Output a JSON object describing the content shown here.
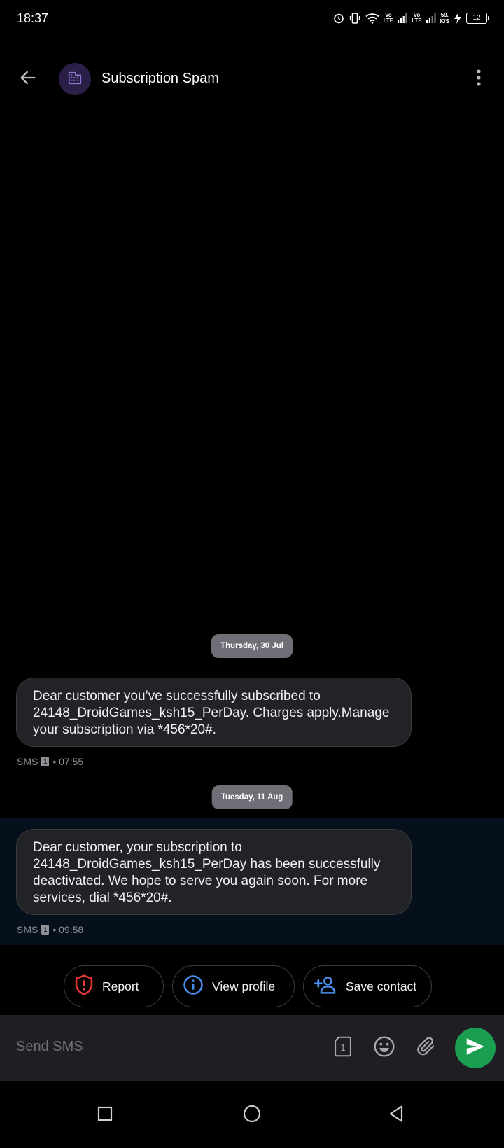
{
  "status_bar": {
    "time": "18:37",
    "lte1": "Vo\nLTE",
    "lte2": "Vo\nLTE",
    "speed": "59.\nK/S",
    "battery": "12"
  },
  "header": {
    "title": "Subscription Spam"
  },
  "conversation": [
    {
      "date": "Thursday, 30 Jul",
      "text": "Dear customer you’ve successfully subscribed to 24148_DroidGames_ksh15_PerDay. Charges apply.Manage your subscription via *456*20#.",
      "channel": "SMS",
      "sim": "1",
      "time": "• 07:55"
    },
    {
      "date": "Tuesday, 11 Aug",
      "text": "Dear customer, your subscription to 24148_DroidGames_ksh15_PerDay has been successfully deactivated. We hope to serve you again soon. For more services, dial *456*20#.",
      "channel": "SMS",
      "sim": "1",
      "time": "• 09:58"
    }
  ],
  "actions": {
    "report": "Report",
    "view_profile": "View profile",
    "save_contact": "Save contact"
  },
  "compose": {
    "placeholder": "Send SMS",
    "sim": "1"
  },
  "colors": {
    "accent_blue": "#4a8ef0",
    "report_red": "#e53935",
    "send_green": "#1a9e4f",
    "avatar_bg": "#2b1e47",
    "avatar_icon": "#8c7bd6"
  }
}
